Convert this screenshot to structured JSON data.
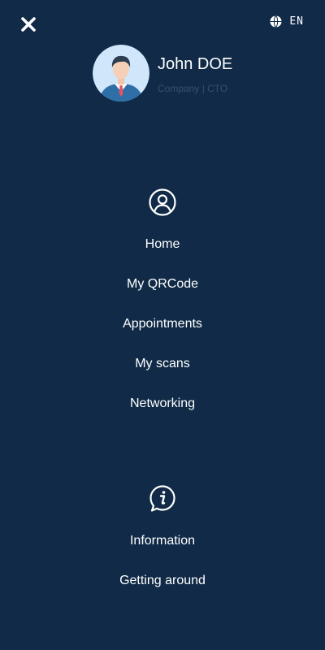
{
  "header": {
    "close_icon": "close-icon",
    "language_icon": "globe-icon",
    "language_code": "EN"
  },
  "profile": {
    "name": "John DOE",
    "role": "Company | CTO"
  },
  "main_menu": {
    "icon": "user-circle-icon",
    "items": [
      {
        "label": "Home"
      },
      {
        "label": "My QRCode"
      },
      {
        "label": "Appointments"
      },
      {
        "label": "My scans"
      },
      {
        "label": "Networking"
      }
    ]
  },
  "info_menu": {
    "icon": "info-icon",
    "items": [
      {
        "label": "Information"
      },
      {
        "label": "Getting around"
      }
    ]
  },
  "colors": {
    "background": "#102a47",
    "text": "#ffffff",
    "muted_text": "#37506e"
  }
}
